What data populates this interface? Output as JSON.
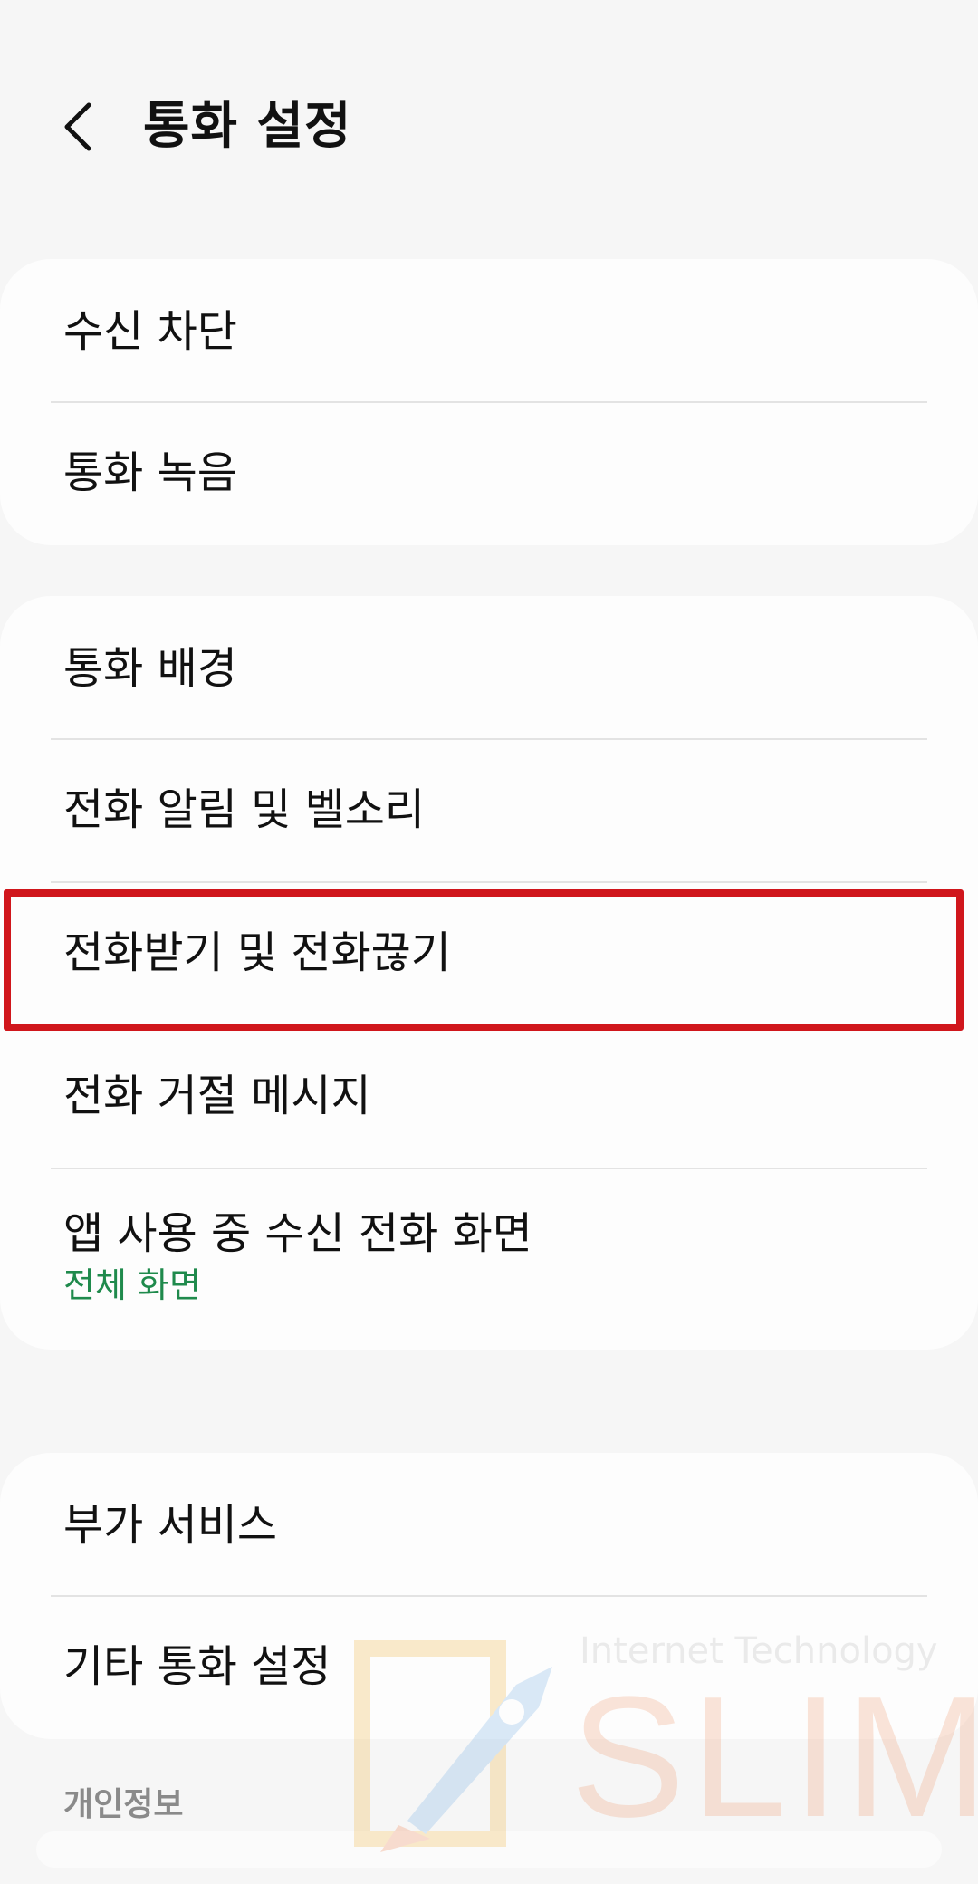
{
  "header": {
    "title": "통화 설정",
    "back_icon": "chevron-left-icon"
  },
  "groups": [
    {
      "items": [
        {
          "label": "수신 차단"
        },
        {
          "label": "통화 녹음"
        }
      ]
    },
    {
      "items": [
        {
          "label": "통화 배경"
        },
        {
          "label": "전화 알림 및 벨소리"
        },
        {
          "label": "전화받기 및 전화끊기",
          "highlighted": true
        },
        {
          "label": "전화 거절 메시지"
        },
        {
          "label": "앱 사용 중 수신 전화 화면",
          "sub": "전체 화면"
        }
      ]
    },
    {
      "items": [
        {
          "label": "부가 서비스"
        },
        {
          "label": "기타 통화 설정"
        }
      ]
    }
  ],
  "section_privacy": "개인정보",
  "watermark": {
    "line": "Internet Technology",
    "brand": "SLIM"
  },
  "colors": {
    "background": "#f6f6f6",
    "card": "#fdfdfd",
    "sub_text": "#1f8a4c",
    "highlight": "#d0161c"
  }
}
